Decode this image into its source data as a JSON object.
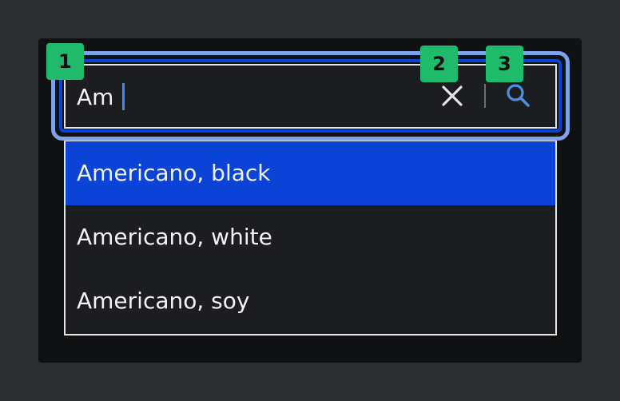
{
  "search": {
    "value": "Am",
    "clear_icon": "close-icon",
    "search_icon": "search-icon"
  },
  "options": [
    {
      "label": "Americano, black",
      "selected": true
    },
    {
      "label": "Americano, white",
      "selected": false
    },
    {
      "label": "Americano, soy",
      "selected": false
    }
  ],
  "badges": [
    "1",
    "2",
    "3"
  ],
  "colors": {
    "background": "#2b2d31",
    "panel": "#0f1112",
    "field": "#1b1d20",
    "focus_outer": "#7fa1ea",
    "focus_inner": "#0a43d6",
    "selected_option": "#0a43d6",
    "caret": "#3c8ef5",
    "search_icon": "#4a90e2",
    "badge": "#1fba6c"
  }
}
